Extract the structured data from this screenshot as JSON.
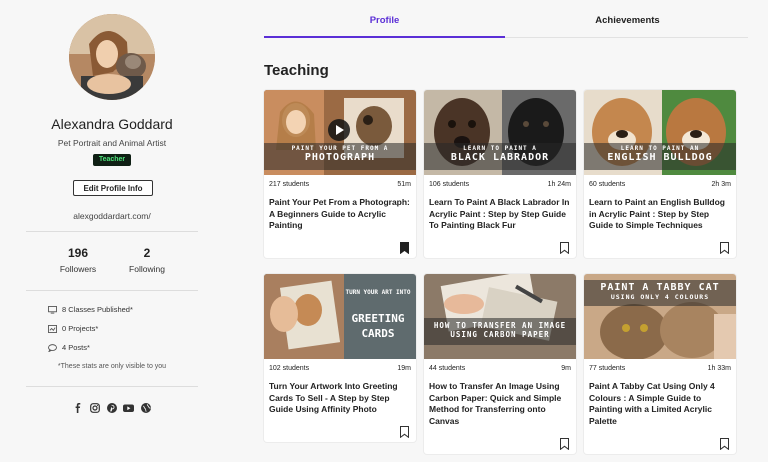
{
  "profile": {
    "name": "Alexandra Goddard",
    "subtitle": "Pet Portrait and Animal Artist",
    "badge": "Teacher",
    "edit_button": "Edit Profile Info",
    "website": "alexgoddardart.com/",
    "followers_count": "196",
    "followers_label": "Followers",
    "following_count": "2",
    "following_label": "Following",
    "classes_published": "8  Classes Published*",
    "projects": "0  Projects*",
    "posts": "4  Posts*",
    "stats_note": "*These stats are only visible to you",
    "social_icons": [
      "facebook-icon",
      "instagram-icon",
      "pinterest-icon",
      "youtube-icon",
      "globe-icon"
    ]
  },
  "tabs": [
    {
      "label": "Profile",
      "active": true
    },
    {
      "label": "Achievements",
      "active": false
    }
  ],
  "section_title": "Teaching",
  "accent_color": "#5b2fd6",
  "cards": [
    {
      "students": "217 students",
      "duration": "51m",
      "title": "Paint Your Pet From a Photograph: A Beginners Guide to Acrylic Painting",
      "thumb_line1": "PAINT YOUR PET FROM A",
      "thumb_line2": "PHOTOGRAPH",
      "saved": true
    },
    {
      "students": "106 students",
      "duration": "1h 24m",
      "title": "Learn To Paint A Black Labrador In Acrylic Paint : Step by Step Guide To Painting Black Fur",
      "thumb_line1": "LEARN TO PAINT A",
      "thumb_line2": "BLACK LABRADOR",
      "saved": false
    },
    {
      "students": "60 students",
      "duration": "2h 3m",
      "title": "Learn to Paint an English Bulldog in Acrylic Paint : Step by Step Guide to Simple Techniques",
      "thumb_line1": "LEARN TO PAINT AN",
      "thumb_line2": "ENGLISH BULLDOG",
      "saved": false
    },
    {
      "students": "102 students",
      "duration": "19m",
      "title": "Turn Your Artwork Into Greeting Cards To Sell - A Step by Step Guide Using Affinity Photo",
      "thumb_line1": "TURN YOUR ART INTO",
      "thumb_line2": "GREETING CARDS",
      "saved": false
    },
    {
      "students": "44 students",
      "duration": "9m",
      "title": "How to Transfer An Image Using Carbon Paper: Quick and Simple Method for Transferring onto Canvas",
      "thumb_line1": "HOW TO TRANSFER AN IMAGE",
      "thumb_line2": "USING CARBON PAPER",
      "saved": false
    },
    {
      "students": "77 students",
      "duration": "1h 33m",
      "title": "Paint A Tabby Cat Using Only 4 Colours : A Simple Guide to Painting with a Limited Acrylic Palette",
      "thumb_line1": "PAINT A TABBY CAT",
      "thumb_line2": "USING ONLY 4 COLOURS",
      "saved": false
    }
  ]
}
